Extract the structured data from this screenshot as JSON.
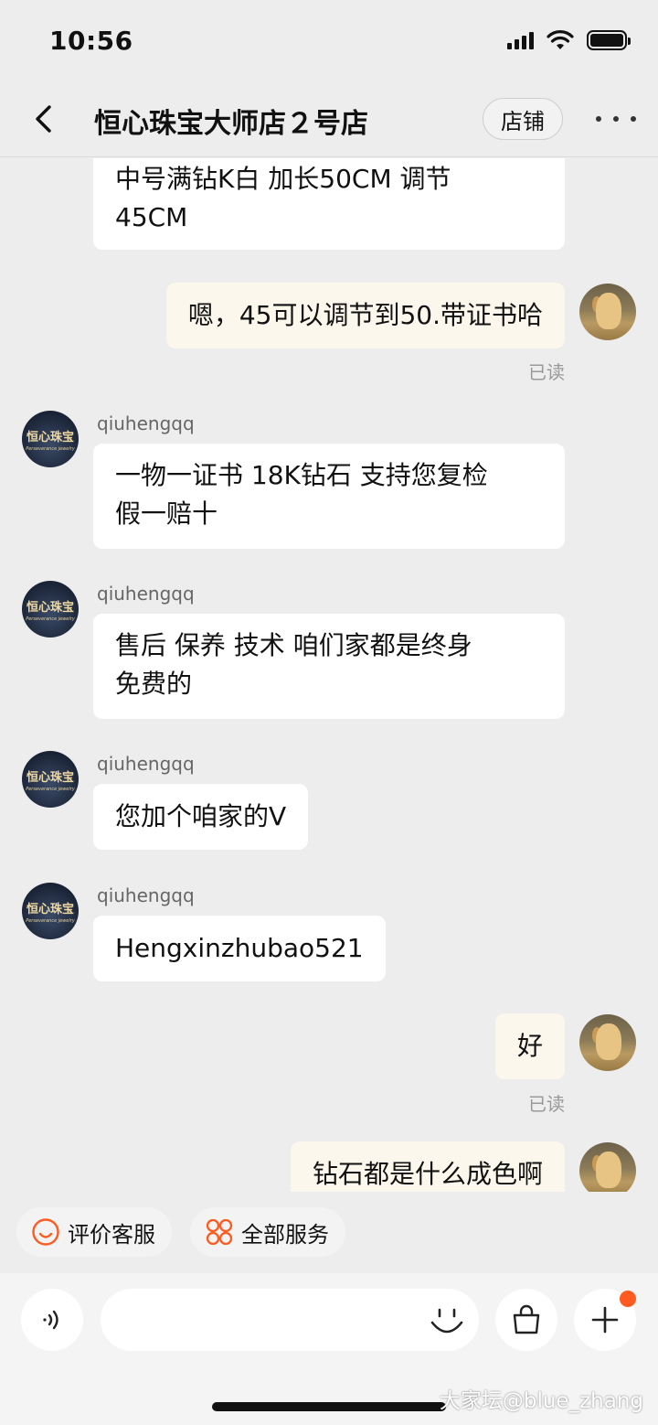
{
  "status_bar": {
    "time": "10:56"
  },
  "header": {
    "title": "恒心珠宝大师店２号店",
    "shop_label": "店铺"
  },
  "shop_avatar": {
    "name": "恒心珠宝",
    "sub": "Perseverance jewelry"
  },
  "messages": [
    {
      "text": "中号满钻K白 加长50CM  调节\n45CM"
    },
    {
      "text": "嗯，45可以调节到50.带证书哈",
      "status": "已读"
    },
    {
      "sender": "qiuhengqq",
      "text": "一物一证书  18K钻石 支持您复检\n假一赔十"
    },
    {
      "sender": "qiuhengqq",
      "text": "售后  保养  技术  咱们家都是终身\n免费的"
    },
    {
      "sender": "qiuhengqq",
      "text": "您加个咱家的V"
    },
    {
      "sender": "qiuhengqq",
      "text": "Hengxinzhubao521"
    },
    {
      "text": "好",
      "status": "已读"
    },
    {
      "text": "钻石都是什么成色啊"
    }
  ],
  "quick_actions": [
    {
      "label": "评价客服",
      "icon": "smiley-icon"
    },
    {
      "label": "全部服务",
      "icon": "grid-icon"
    }
  ],
  "input": {
    "placeholder": ""
  },
  "watermark": "大家坛@blue_zhang",
  "colors": {
    "accent": "#ff5a1f",
    "outgoing_bubble": "#fbf7ec",
    "incoming_bubble": "#ffffff",
    "background": "#ededed"
  }
}
